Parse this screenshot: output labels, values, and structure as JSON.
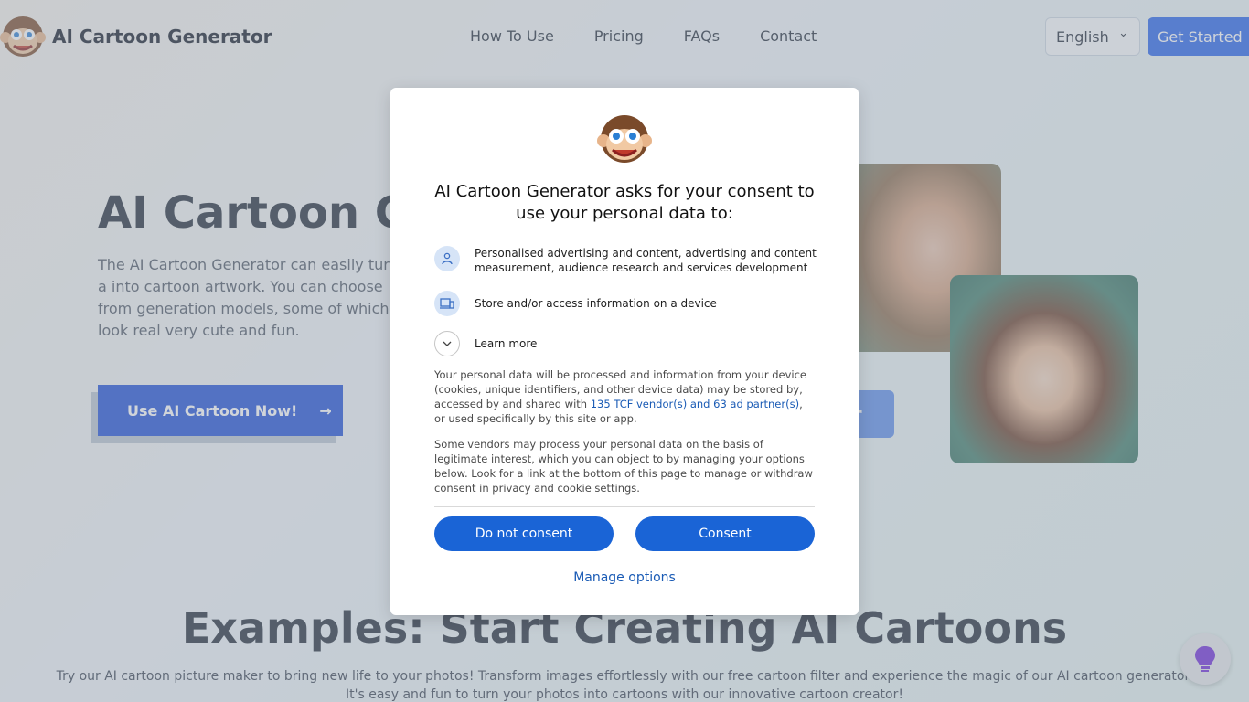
{
  "header": {
    "brand": "AI Cartoon Generator",
    "nav": [
      "How To Use",
      "Pricing",
      "FAQs",
      "Contact"
    ],
    "language": "English",
    "get_started": "Get Started"
  },
  "hero": {
    "title": "AI Cartoon Ge",
    "description": "The AI Cartoon Generator can easily turn a into cartoon artwork. You can choose from generation models, some of which look real very cute and fun.",
    "cta": "Use AI Cartoon Now!",
    "ghost_label": "or"
  },
  "examples": {
    "title": "Examples: Start Creating AI Cartoons",
    "description": "Try our AI cartoon picture maker to bring new life to your photos! Transform images effortlessly with our free cartoon filter and experience the magic of our AI cartoon generator. It's easy and fun to turn your photos into cartoons with our innovative cartoon creator!"
  },
  "consent": {
    "title": "AI Cartoon Generator asks for your consent to use your personal data to:",
    "purposes": [
      "Personalised advertising and content, advertising and content measurement, audience research and services development",
      "Store and/or access information on a device"
    ],
    "learn_more": "Learn more",
    "para1_before": "Your personal data will be processed and information from your device (cookies, unique identifiers, and other device data) may be stored by, accessed by and shared with ",
    "para1_link": "135 TCF vendor(s) and 63 ad partner(s)",
    "para1_after": ", or used specifically by this site or app.",
    "para2": "Some vendors may process your personal data on the basis of legitimate interest, which you can object to by managing your options below. Look for a link at the bottom of this page to manage or withdraw consent in privacy and cookie settings.",
    "do_not_consent": "Do not consent",
    "consent": "Consent",
    "manage_options": "Manage options"
  },
  "colors": {
    "primary": "#1a64d6",
    "link": "#1a5bb5",
    "hero_cta": "#1d4ed8"
  }
}
